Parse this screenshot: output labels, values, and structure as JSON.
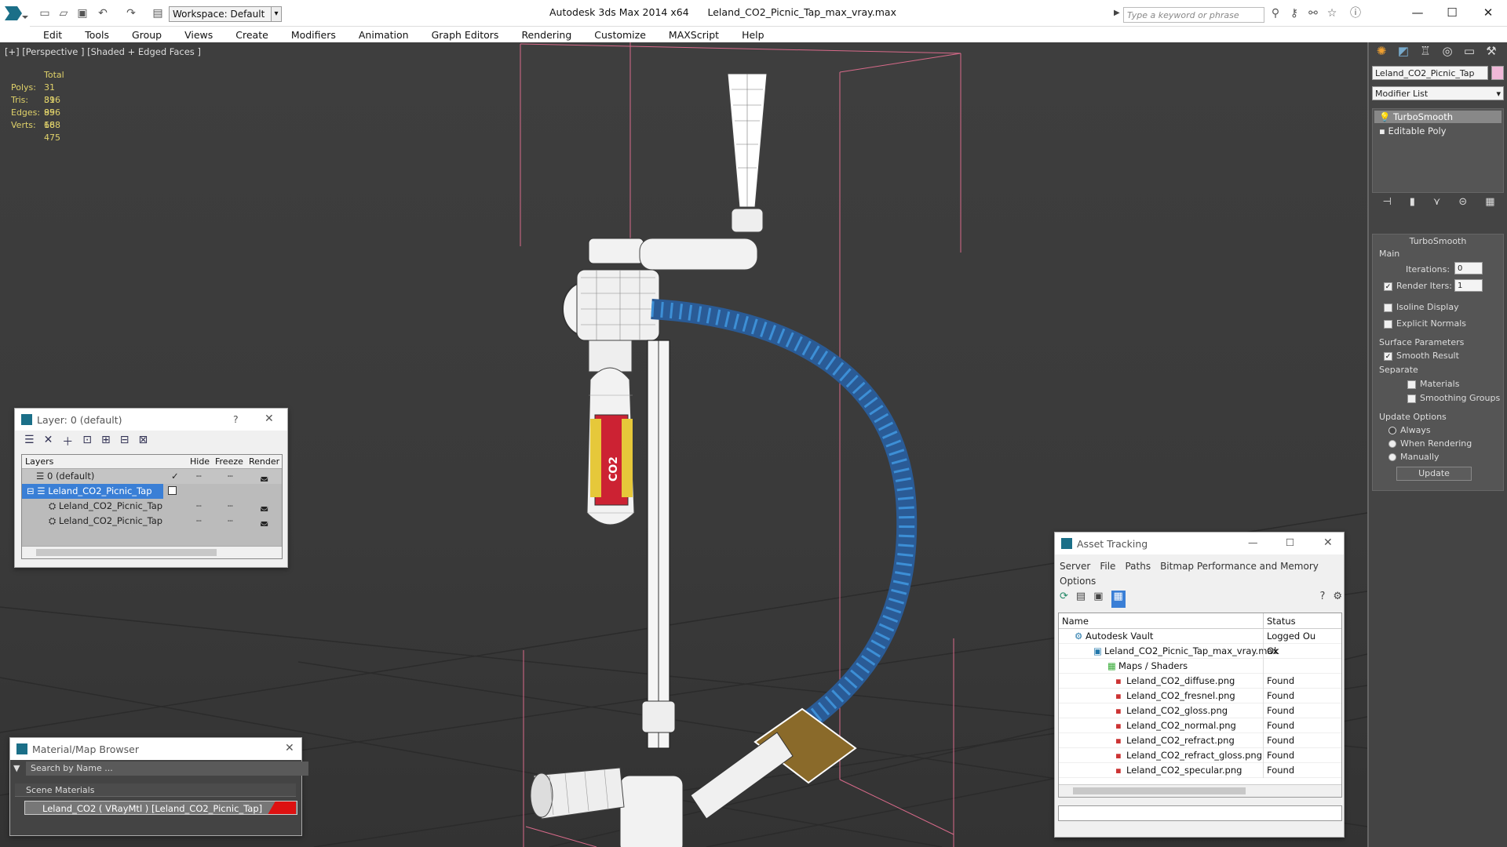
{
  "app": {
    "title": "Autodesk 3ds Max  2014 x64",
    "filename": "Leland_CO2_Picnic_Tap_max_vray.max",
    "workspace": "Workspace: Default",
    "search_placeholder": "Type a keyword or phrase"
  },
  "menu": [
    "Edit",
    "Tools",
    "Group",
    "Views",
    "Create",
    "Modifiers",
    "Animation",
    "Graph Editors",
    "Rendering",
    "Customize",
    "MAXScript",
    "Help"
  ],
  "viewport": {
    "label": "[+] [Perspective ] [Shaded + Edged Faces ]",
    "stats": {
      "header": "Total",
      "rows": [
        {
          "k": "Polys:",
          "v": "31 896"
        },
        {
          "k": "Tris:",
          "v": "31 896"
        },
        {
          "k": "Edges:",
          "v": "95 688"
        },
        {
          "k": "Verts:",
          "v": "16 475"
        }
      ]
    }
  },
  "command_panel": {
    "object_name": "Leland_CO2_Picnic_Tap",
    "modifier_list": "Modifier List",
    "stack": [
      "TurboSmooth",
      "Editable Poly"
    ],
    "rollout": "TurboSmooth",
    "main": "Main",
    "iterations_label": "Iterations:",
    "iterations": "0",
    "render_iters_label": "Render Iters:",
    "render_iters": "1",
    "isoline": "Isoline Display",
    "explicit": "Explicit Normals",
    "surface": "Surface Parameters",
    "smooth": "Smooth Result",
    "separate": "Separate",
    "materials": "Materials",
    "smoothing": "Smoothing Groups",
    "update_options": "Update Options",
    "always": "Always",
    "when_rendering": "When Rendering",
    "manually": "Manually",
    "update": "Update"
  },
  "layer_dialog": {
    "title": "Layer: 0 (default)",
    "help": "?",
    "cols": [
      "Layers",
      "Hide",
      "Freeze",
      "Render"
    ],
    "rows": [
      "0 (default)",
      "Leland_CO2_Picnic_Tap",
      "Leland_CO2_Picnic_Tap",
      "Leland_CO2_Picnic_Tap"
    ]
  },
  "material_browser": {
    "title": "Material/Map Browser",
    "search": "Search by Name ...",
    "section": "Scene Materials",
    "item": "Leland_CO2  ( VRayMtl ) [Leland_CO2_Picnic_Tap]"
  },
  "asset_tracking": {
    "title": "Asset Tracking",
    "menu": [
      "Server",
      "File",
      "Paths",
      "Bitmap Performance and Memory",
      "Options"
    ],
    "cols": [
      "Name",
      "Status"
    ],
    "rows": [
      {
        "n": "Autodesk Vault",
        "s": "Logged Ou"
      },
      {
        "n": "Leland_CO2_Picnic_Tap_max_vray.max",
        "s": "Ok"
      },
      {
        "n": "Maps / Shaders",
        "s": ""
      },
      {
        "n": "Leland_CO2_diffuse.png",
        "s": "Found"
      },
      {
        "n": "Leland_CO2_fresnel.png",
        "s": "Found"
      },
      {
        "n": "Leland_CO2_gloss.png",
        "s": "Found"
      },
      {
        "n": "Leland_CO2_normal.png",
        "s": "Found"
      },
      {
        "n": "Leland_CO2_refract.png",
        "s": "Found"
      },
      {
        "n": "Leland_CO2_refract_gloss.png",
        "s": "Found"
      },
      {
        "n": "Leland_CO2_specular.png",
        "s": "Found"
      }
    ]
  }
}
